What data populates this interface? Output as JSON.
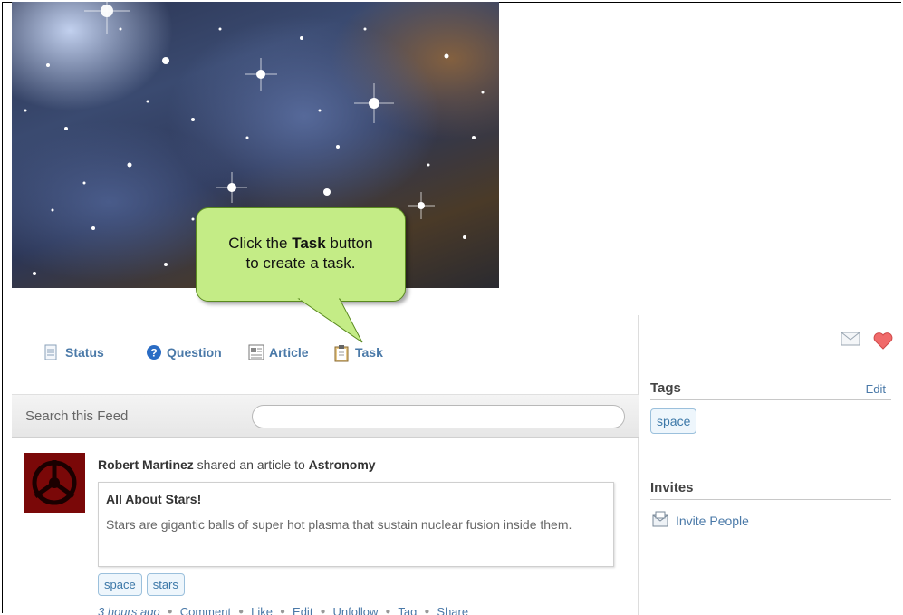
{
  "callout": {
    "before": "Click the ",
    "bold": "Task",
    "after": " button",
    "line2": "to create a task."
  },
  "composer": {
    "tabs": [
      {
        "label": "Status",
        "icon": "document-icon"
      },
      {
        "label": "Question",
        "icon": "question-icon"
      },
      {
        "label": "Article",
        "icon": "article-icon"
      },
      {
        "label": "Task",
        "icon": "clipboard-icon"
      }
    ]
  },
  "search": {
    "label": "Search this Feed",
    "value": "",
    "placeholder": ""
  },
  "post": {
    "author": "Robert Martinez",
    "verb": " shared an article to ",
    "group": "Astronomy",
    "article_title": "All About Stars!",
    "article_body": "Stars are gigantic balls of super hot plasma that sustain nuclear fusion inside them.",
    "tags": [
      "space",
      "stars"
    ],
    "time": "3 hours ago",
    "actions": [
      "Comment",
      "Like",
      "Edit",
      "Unfollow",
      "Tag",
      "Share"
    ]
  },
  "sidebar": {
    "tags_title": "Tags",
    "tags_edit": "Edit",
    "tags": [
      "space"
    ],
    "invites_title": "Invites",
    "invite_label": "Invite People"
  },
  "colors": {
    "link": "#4a79a8",
    "callout": "#c4ec86",
    "tag_border": "#9bc0dc"
  }
}
